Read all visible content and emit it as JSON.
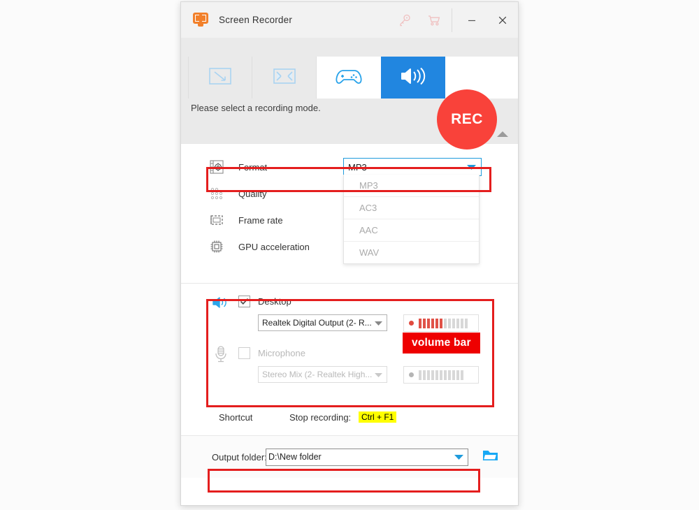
{
  "window": {
    "title": "Screen Recorder",
    "titlebar_icons": [
      "key-icon",
      "cart-icon",
      "minimize-icon",
      "close-icon"
    ]
  },
  "modebar": {
    "modes": [
      {
        "name": "custom-region",
        "icon": "region-arrow-icon",
        "state": "idle"
      },
      {
        "name": "full-screen",
        "icon": "fullscreen-icon",
        "state": "idle"
      },
      {
        "name": "game-recording",
        "icon": "gamepad-icon",
        "state": "hover"
      },
      {
        "name": "audio-recording",
        "icon": "speaker-icon",
        "state": "selected"
      }
    ],
    "rec_label": "REC",
    "hint": "Please select a recording mode.",
    "collapse_icon": "chevron-up-icon"
  },
  "settings": {
    "rows": [
      {
        "label": "Format",
        "icon": "format-gear-icon"
      },
      {
        "label": "Quality",
        "icon": "quality-dots-icon"
      },
      {
        "label": "Frame rate",
        "icon": "frame-rate-icon"
      },
      {
        "label": "GPU acceleration",
        "icon": "gpu-chip-icon"
      }
    ],
    "format": {
      "selected": "MP3",
      "options": [
        "MP3",
        "AC3",
        "AAC",
        "WAV"
      ]
    }
  },
  "audio": {
    "desktop": {
      "label": "Desktop",
      "checked": true,
      "device": "Realtek Digital Output (2- R...",
      "volume_active_bars": 6,
      "volume_total_bars": 12
    },
    "microphone": {
      "label": "Microphone",
      "checked": false,
      "device": "Stereo Mix (2- Realtek High...",
      "volume_active_bars": 0,
      "volume_total_bars": 11
    },
    "annotation_badge": "volume bar"
  },
  "shortcut": {
    "label": "Shortcut",
    "action_label": "Stop recording:",
    "keys": "Ctrl + F1"
  },
  "output": {
    "label": "Output folder:",
    "path": "D:\\New folder",
    "browse_icon": "folder-icon"
  },
  "colors": {
    "accent_blue": "#2186e0",
    "rec_red": "#f9423a",
    "annotation_red": "#e41e1e",
    "badge_red": "#ee0000",
    "highlight_yellow": "#ffff00",
    "brand_orange": "#f2802a"
  }
}
